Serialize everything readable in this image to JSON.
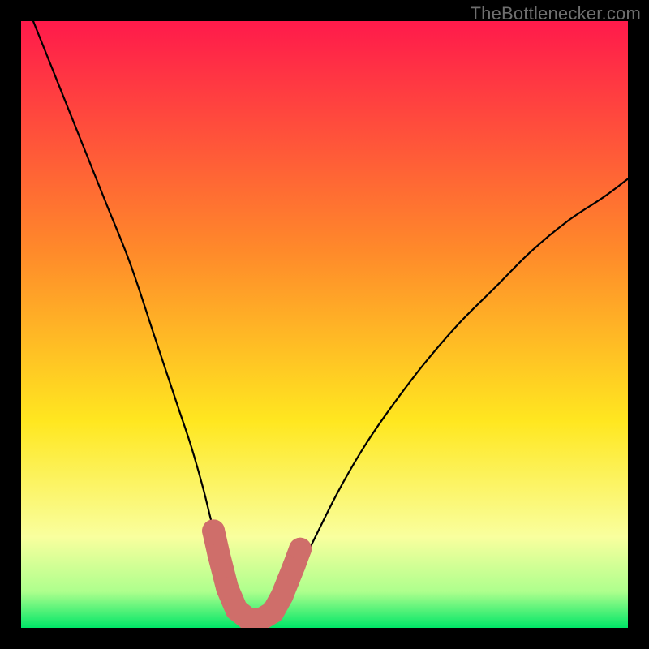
{
  "watermark": "TheBottlenecker.com",
  "colors": {
    "frame": "#000000",
    "grad_top": "#ff1a4b",
    "grad_orange": "#ff8a2a",
    "grad_yellow": "#ffe720",
    "grad_lightyellow": "#f9ff9e",
    "grad_green_light": "#aeff8d",
    "grad_green": "#00e667",
    "curve": "#000000",
    "marker_fill": "#cf6e6a",
    "marker_stroke": "#cf6e6a"
  },
  "chart_data": {
    "type": "line",
    "title": "",
    "xlabel": "",
    "ylabel": "",
    "xlim": [
      0,
      100
    ],
    "ylim": [
      0,
      100
    ],
    "series": [
      {
        "name": "bottleneck-curve",
        "x": [
          2,
          6,
          10,
          14,
          18,
          22,
          24,
          26,
          28,
          30,
          31.5,
          33,
          34.5,
          35.5,
          36.5,
          38,
          39.5,
          41.5,
          43,
          44,
          46,
          48,
          52,
          56,
          60,
          66,
          72,
          78,
          84,
          90,
          96,
          100
        ],
        "y": [
          100,
          90,
          80,
          70,
          60,
          48,
          42,
          36,
          30,
          23,
          17,
          12,
          7,
          4,
          2,
          1,
          1,
          2,
          4,
          6,
          10,
          14,
          22,
          29,
          35,
          43,
          50,
          56,
          62,
          67,
          71,
          74
        ]
      }
    ],
    "markers": {
      "name": "highlighted-points",
      "points": [
        [
          31.7,
          16
        ],
        [
          32.6,
          12
        ],
        [
          34.0,
          6.5
        ],
        [
          35.5,
          3.0
        ],
        [
          37.5,
          1.4
        ],
        [
          39.5,
          1.4
        ],
        [
          41.5,
          2.6
        ],
        [
          43.0,
          5.3
        ],
        [
          44.0,
          7.8
        ],
        [
          45.0,
          10.3
        ],
        [
          46.0,
          13.0
        ]
      ],
      "size": 14
    },
    "legend": false,
    "grid": false
  }
}
